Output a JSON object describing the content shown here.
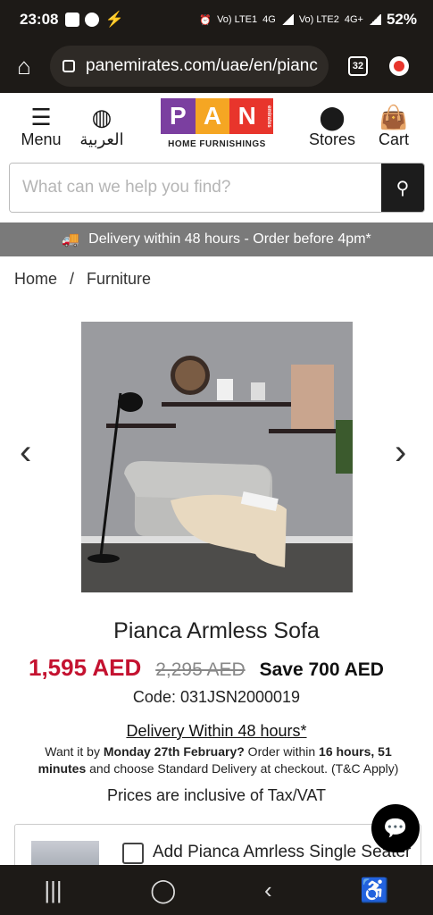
{
  "status": {
    "time": "23:08",
    "network1": "Vo) LTE1",
    "network2": "Vo) LTE2",
    "gen": "4G",
    "gen2": "4G+",
    "battery": "52%"
  },
  "browser": {
    "url": "panemirates.com/uae/en/pianc",
    "tab_count": "32"
  },
  "header": {
    "menu_label": "Menu",
    "arabic_label": "العربية",
    "stores_label": "Stores",
    "cart_label": "Cart",
    "logo_letters": [
      "P",
      "A",
      "N"
    ],
    "logo_side": "emirates",
    "logo_subtitle": "HOME FURNISHINGS",
    "logo_colors": [
      "#7b3fa0",
      "#f5a623",
      "#e8352c"
    ]
  },
  "search": {
    "placeholder": "What can we help you find?"
  },
  "banner": {
    "text": "Delivery within 48 hours - Order before 4pm*"
  },
  "breadcrumb": {
    "home": "Home",
    "separator": "/",
    "current": "Furniture"
  },
  "product": {
    "title": "Pianca Armless Sofa",
    "price": "1,595 AED",
    "old_price": "2,295 AED",
    "save": "Save 700 AED",
    "code": "Code: 031JSN2000019",
    "delivery_link": "Delivery Within 48 hours*",
    "delivery_pre": "Want it by ",
    "delivery_date": "Monday 27th February?",
    "delivery_mid": " Order within ",
    "delivery_time": "16 hours, 51 minutes",
    "delivery_post": " and choose Standard Delivery at checkout. (T&C Apply)",
    "vat": "Prices are inclusive of Tax/VAT",
    "addon_label": "Add Pianca Amrless Single Seater"
  },
  "colors": {
    "price_red": "#c41230",
    "bar_dark": "#1d1a17",
    "banner_gray": "#7a7a7a"
  }
}
